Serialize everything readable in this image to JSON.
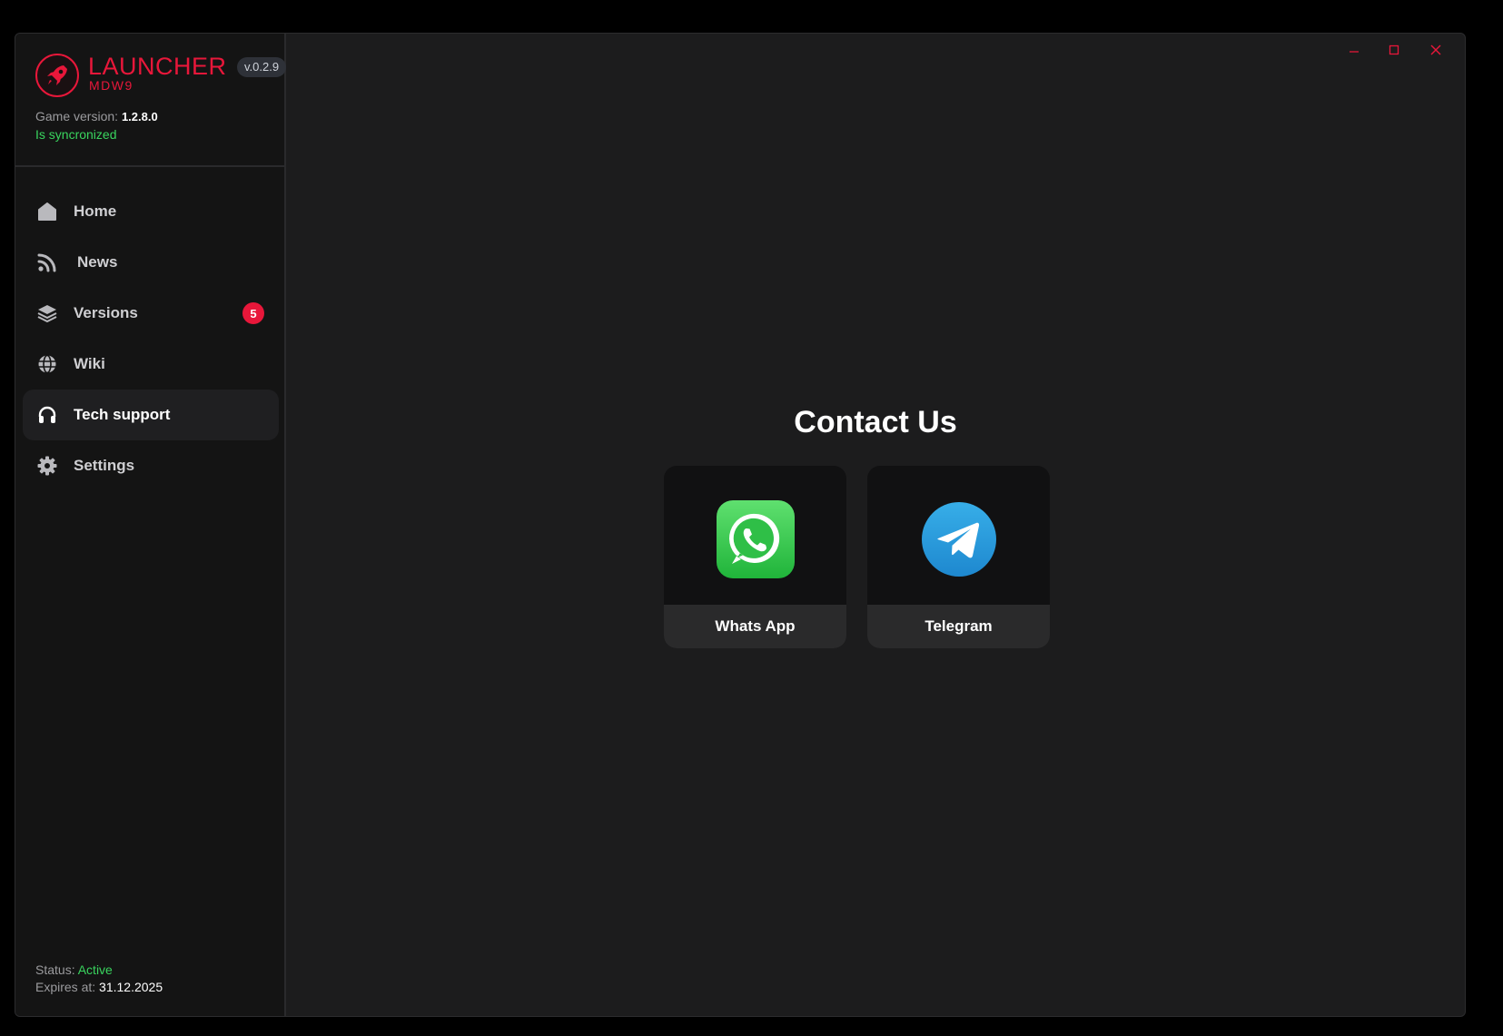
{
  "brand": {
    "name": "LAUNCHER",
    "subtitle": "MDW9",
    "version": "v.0.2.9",
    "accent_color": "#e8173a",
    "logo_icon": "rocket-icon"
  },
  "game": {
    "version_label": "Game version:",
    "version_value": "1.2.8.0",
    "sync_status": "Is syncronized"
  },
  "nav": {
    "items": [
      {
        "label": "Home",
        "icon": "home-icon"
      },
      {
        "label": "News",
        "icon": "rss-icon"
      },
      {
        "label": "Versions",
        "icon": "layers-icon",
        "badge": "5"
      },
      {
        "label": "Wiki",
        "icon": "globe-icon"
      },
      {
        "label": "Tech support",
        "icon": "headphones-icon",
        "active": true
      },
      {
        "label": "Settings",
        "icon": "gear-icon"
      }
    ]
  },
  "footer": {
    "status_label": "Status:",
    "status_value": "Active",
    "expires_label": "Expires at:",
    "expires_value": "31.12.2025"
  },
  "window_controls": [
    "minimize-icon",
    "maximize-icon",
    "close-icon"
  ],
  "main": {
    "title": "Contact Us",
    "cards": [
      {
        "label": "Whats App",
        "icon": "whatsapp-icon",
        "color": "#30c24a"
      },
      {
        "label": "Telegram",
        "icon": "telegram-icon",
        "color": "#2aa3e0"
      }
    ]
  }
}
